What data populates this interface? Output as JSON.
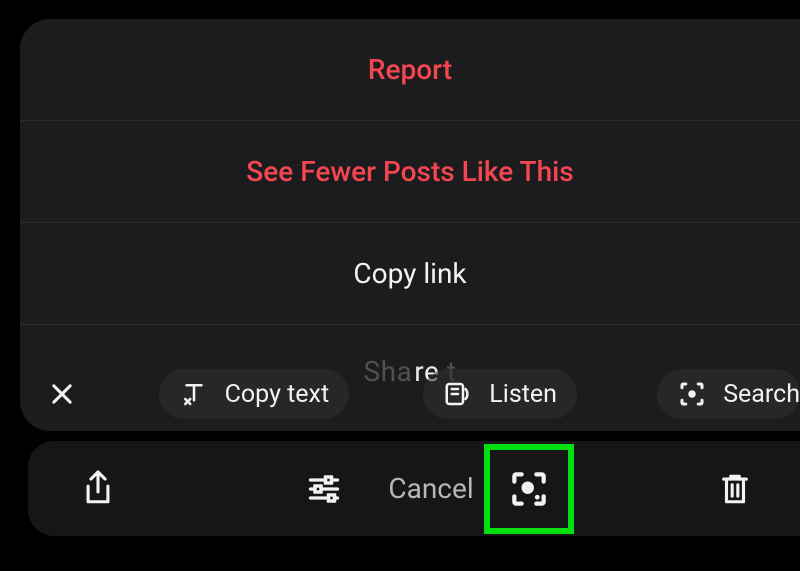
{
  "sheet": {
    "report": "Report",
    "see_fewer": "See Fewer Posts Like This",
    "copy_link": "Copy link",
    "share_fragment_prefix": "Sha",
    "share_fragment_mid": "re",
    "share_fragment_suffix": " t"
  },
  "smartbar": {
    "close_icon": "close-icon",
    "copy_text": "Copy text",
    "listen": "Listen",
    "search": "Search"
  },
  "bottombar": {
    "cancel": "Cancel"
  },
  "colors": {
    "destructive": "#f44651",
    "highlight": "#00e010",
    "sheet_bg": "#1c1c1e"
  }
}
